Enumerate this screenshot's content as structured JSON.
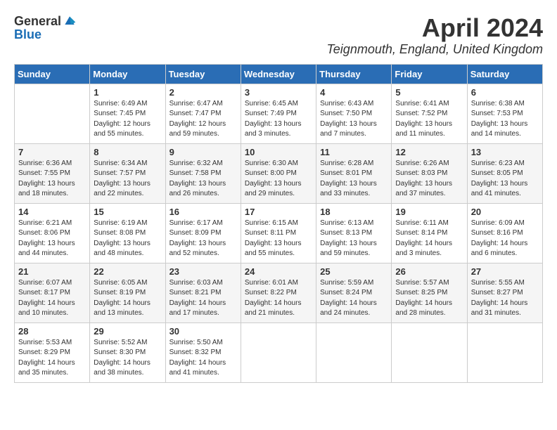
{
  "logo": {
    "general": "General",
    "blue": "Blue"
  },
  "title": "April 2024",
  "location": "Teignmouth, England, United Kingdom",
  "days_of_week": [
    "Sunday",
    "Monday",
    "Tuesday",
    "Wednesday",
    "Thursday",
    "Friday",
    "Saturday"
  ],
  "weeks": [
    [
      {
        "day": "",
        "content": ""
      },
      {
        "day": "1",
        "content": "Sunrise: 6:49 AM\nSunset: 7:45 PM\nDaylight: 12 hours\nand 55 minutes."
      },
      {
        "day": "2",
        "content": "Sunrise: 6:47 AM\nSunset: 7:47 PM\nDaylight: 12 hours\nand 59 minutes."
      },
      {
        "day": "3",
        "content": "Sunrise: 6:45 AM\nSunset: 7:49 PM\nDaylight: 13 hours\nand 3 minutes."
      },
      {
        "day": "4",
        "content": "Sunrise: 6:43 AM\nSunset: 7:50 PM\nDaylight: 13 hours\nand 7 minutes."
      },
      {
        "day": "5",
        "content": "Sunrise: 6:41 AM\nSunset: 7:52 PM\nDaylight: 13 hours\nand 11 minutes."
      },
      {
        "day": "6",
        "content": "Sunrise: 6:38 AM\nSunset: 7:53 PM\nDaylight: 13 hours\nand 14 minutes."
      }
    ],
    [
      {
        "day": "7",
        "content": "Sunrise: 6:36 AM\nSunset: 7:55 PM\nDaylight: 13 hours\nand 18 minutes."
      },
      {
        "day": "8",
        "content": "Sunrise: 6:34 AM\nSunset: 7:57 PM\nDaylight: 13 hours\nand 22 minutes."
      },
      {
        "day": "9",
        "content": "Sunrise: 6:32 AM\nSunset: 7:58 PM\nDaylight: 13 hours\nand 26 minutes."
      },
      {
        "day": "10",
        "content": "Sunrise: 6:30 AM\nSunset: 8:00 PM\nDaylight: 13 hours\nand 29 minutes."
      },
      {
        "day": "11",
        "content": "Sunrise: 6:28 AM\nSunset: 8:01 PM\nDaylight: 13 hours\nand 33 minutes."
      },
      {
        "day": "12",
        "content": "Sunrise: 6:26 AM\nSunset: 8:03 PM\nDaylight: 13 hours\nand 37 minutes."
      },
      {
        "day": "13",
        "content": "Sunrise: 6:23 AM\nSunset: 8:05 PM\nDaylight: 13 hours\nand 41 minutes."
      }
    ],
    [
      {
        "day": "14",
        "content": "Sunrise: 6:21 AM\nSunset: 8:06 PM\nDaylight: 13 hours\nand 44 minutes."
      },
      {
        "day": "15",
        "content": "Sunrise: 6:19 AM\nSunset: 8:08 PM\nDaylight: 13 hours\nand 48 minutes."
      },
      {
        "day": "16",
        "content": "Sunrise: 6:17 AM\nSunset: 8:09 PM\nDaylight: 13 hours\nand 52 minutes."
      },
      {
        "day": "17",
        "content": "Sunrise: 6:15 AM\nSunset: 8:11 PM\nDaylight: 13 hours\nand 55 minutes."
      },
      {
        "day": "18",
        "content": "Sunrise: 6:13 AM\nSunset: 8:13 PM\nDaylight: 13 hours\nand 59 minutes."
      },
      {
        "day": "19",
        "content": "Sunrise: 6:11 AM\nSunset: 8:14 PM\nDaylight: 14 hours\nand 3 minutes."
      },
      {
        "day": "20",
        "content": "Sunrise: 6:09 AM\nSunset: 8:16 PM\nDaylight: 14 hours\nand 6 minutes."
      }
    ],
    [
      {
        "day": "21",
        "content": "Sunrise: 6:07 AM\nSunset: 8:17 PM\nDaylight: 14 hours\nand 10 minutes."
      },
      {
        "day": "22",
        "content": "Sunrise: 6:05 AM\nSunset: 8:19 PM\nDaylight: 14 hours\nand 13 minutes."
      },
      {
        "day": "23",
        "content": "Sunrise: 6:03 AM\nSunset: 8:21 PM\nDaylight: 14 hours\nand 17 minutes."
      },
      {
        "day": "24",
        "content": "Sunrise: 6:01 AM\nSunset: 8:22 PM\nDaylight: 14 hours\nand 21 minutes."
      },
      {
        "day": "25",
        "content": "Sunrise: 5:59 AM\nSunset: 8:24 PM\nDaylight: 14 hours\nand 24 minutes."
      },
      {
        "day": "26",
        "content": "Sunrise: 5:57 AM\nSunset: 8:25 PM\nDaylight: 14 hours\nand 28 minutes."
      },
      {
        "day": "27",
        "content": "Sunrise: 5:55 AM\nSunset: 8:27 PM\nDaylight: 14 hours\nand 31 minutes."
      }
    ],
    [
      {
        "day": "28",
        "content": "Sunrise: 5:53 AM\nSunset: 8:29 PM\nDaylight: 14 hours\nand 35 minutes."
      },
      {
        "day": "29",
        "content": "Sunrise: 5:52 AM\nSunset: 8:30 PM\nDaylight: 14 hours\nand 38 minutes."
      },
      {
        "day": "30",
        "content": "Sunrise: 5:50 AM\nSunset: 8:32 PM\nDaylight: 14 hours\nand 41 minutes."
      },
      {
        "day": "",
        "content": ""
      },
      {
        "day": "",
        "content": ""
      },
      {
        "day": "",
        "content": ""
      },
      {
        "day": "",
        "content": ""
      }
    ]
  ]
}
